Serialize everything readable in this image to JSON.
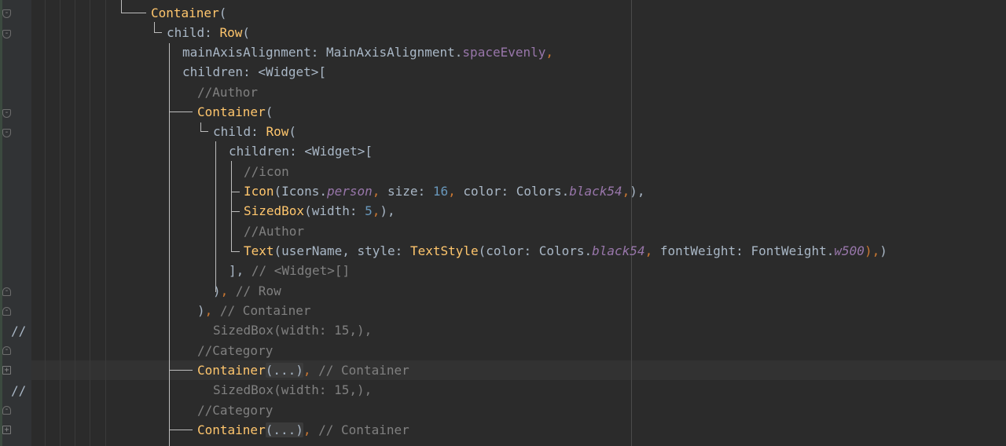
{
  "gutter": {
    "comment_markers": [
      "//",
      "//"
    ]
  },
  "editor": {
    "lines": [
      {
        "id": "l1",
        "segments": [
          {
            "t": "Container",
            "c": "fn"
          },
          {
            "t": "(",
            "c": "txt"
          }
        ]
      },
      {
        "id": "l2",
        "segments": [
          {
            "t": "child: ",
            "c": "txt"
          },
          {
            "t": "Row",
            "c": "fn"
          },
          {
            "t": "(",
            "c": "txt"
          }
        ]
      },
      {
        "id": "l3",
        "segments": [
          {
            "t": "mainAxisAlignment: MainAxisAlignment.",
            "c": "txt"
          },
          {
            "t": "spaceEvenly",
            "c": "prop"
          },
          {
            "t": ",",
            "c": "kw"
          }
        ]
      },
      {
        "id": "l4",
        "segments": [
          {
            "t": "children: <Widget>[",
            "c": "txt"
          }
        ]
      },
      {
        "id": "l5",
        "segments": [
          {
            "t": "//Author",
            "c": "cm"
          }
        ]
      },
      {
        "id": "l6",
        "segments": [
          {
            "t": "Container",
            "c": "fn"
          },
          {
            "t": "(",
            "c": "txt"
          }
        ]
      },
      {
        "id": "l7",
        "segments": [
          {
            "t": "child: ",
            "c": "txt"
          },
          {
            "t": "Row",
            "c": "fn"
          },
          {
            "t": "(",
            "c": "txt"
          }
        ]
      },
      {
        "id": "l8",
        "segments": [
          {
            "t": "children: <Widget>[",
            "c": "txt"
          }
        ]
      },
      {
        "id": "l9",
        "segments": [
          {
            "t": "//icon",
            "c": "cm"
          }
        ]
      },
      {
        "id": "l10",
        "segments": [
          {
            "t": "Icon",
            "c": "fn"
          },
          {
            "t": "(Icons.",
            "c": "txt"
          },
          {
            "t": "person",
            "c": "ital"
          },
          {
            "t": ", ",
            "c": "kw"
          },
          {
            "t": "size: ",
            "c": "txt"
          },
          {
            "t": "16",
            "c": "num"
          },
          {
            "t": ", ",
            "c": "kw"
          },
          {
            "t": "color: Colors.",
            "c": "txt"
          },
          {
            "t": "black54",
            "c": "ital"
          },
          {
            "t": ",",
            "c": "kw"
          },
          {
            "t": "),",
            "c": "txt"
          }
        ]
      },
      {
        "id": "l11",
        "segments": [
          {
            "t": "SizedBox",
            "c": "fn"
          },
          {
            "t": "(width: ",
            "c": "txt"
          },
          {
            "t": "5",
            "c": "num"
          },
          {
            "t": ",",
            "c": "kw"
          },
          {
            "t": "),",
            "c": "txt"
          }
        ]
      },
      {
        "id": "l12",
        "segments": [
          {
            "t": "//Author",
            "c": "cm"
          }
        ]
      },
      {
        "id": "l13",
        "segments": [
          {
            "t": "Text",
            "c": "fn"
          },
          {
            "t": "(userName, ",
            "c": "txt"
          },
          {
            "t": "style: ",
            "c": "txt"
          },
          {
            "t": "TextStyle",
            "c": "fn"
          },
          {
            "t": "(color: Colors.",
            "c": "txt"
          },
          {
            "t": "black54",
            "c": "ital"
          },
          {
            "t": ", ",
            "c": "kw"
          },
          {
            "t": "fontWeight: FontWeight.",
            "c": "txt"
          },
          {
            "t": "w500",
            "c": "ital"
          },
          {
            "t": "),",
            "c": "kw"
          },
          {
            "t": ")",
            "c": "txt"
          }
        ]
      },
      {
        "id": "l14",
        "segments": [
          {
            "t": "], ",
            "c": "txt"
          },
          {
            "t": "// <Widget>[]",
            "c": "cm"
          }
        ]
      },
      {
        "id": "l15",
        "segments": [
          {
            "t": ")",
            "c": "txt"
          },
          {
            "t": ", ",
            "c": "kw"
          },
          {
            "t": "// Row",
            "c": "cm"
          }
        ]
      },
      {
        "id": "l16",
        "segments": [
          {
            "t": ")",
            "c": "txt"
          },
          {
            "t": ", ",
            "c": "kw"
          },
          {
            "t": "// Container",
            "c": "cm"
          }
        ]
      },
      {
        "id": "l17",
        "segments": [
          {
            "t": "SizedBox(width: 15,),",
            "c": "cm"
          }
        ]
      },
      {
        "id": "l18",
        "segments": [
          {
            "t": "//Category",
            "c": "cm"
          }
        ]
      },
      {
        "id": "l19",
        "segments": [
          {
            "t": "Container",
            "c": "fn"
          },
          {
            "t": "(...)",
            "c": "fold-box"
          },
          {
            "t": ", ",
            "c": "kw"
          },
          {
            "t": "// Container",
            "c": "cm"
          }
        ]
      },
      {
        "id": "l20",
        "segments": [
          {
            "t": "SizedBox(width: 15,),",
            "c": "cm"
          }
        ]
      },
      {
        "id": "l21",
        "segments": [
          {
            "t": "//Category",
            "c": "cm"
          }
        ]
      },
      {
        "id": "l22",
        "segments": [
          {
            "t": "Container",
            "c": "fn"
          },
          {
            "t": "(...)",
            "c": "fold-box"
          },
          {
            "t": ", ",
            "c": "kw"
          },
          {
            "t": "// Container",
            "c": "cm"
          }
        ]
      }
    ]
  }
}
